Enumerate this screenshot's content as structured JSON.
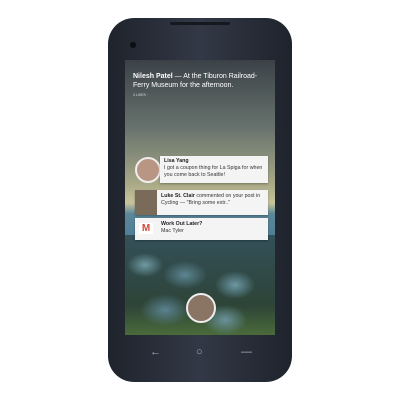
{
  "story": {
    "author": "Nilesh Patel",
    "text": " — At the Tiburon Railroad-Ferry Museum for the afternoon.",
    "meta": "4 LIKES ·"
  },
  "notifications": [
    {
      "name": "Lisa Yang",
      "text": "I got a coupon thing for La Spiga for when you come back to Seattle!"
    },
    {
      "name": "Luke St. Clair",
      "text": " commented on your post in Cycling — \"Bring some extr..\""
    },
    {
      "name": "Work Out Later?",
      "text": "Mac Tyler",
      "icon": "gmail-icon",
      "accent": "#d14836"
    }
  ],
  "nav": {
    "back": "←",
    "home": "○",
    "menu": "—"
  }
}
